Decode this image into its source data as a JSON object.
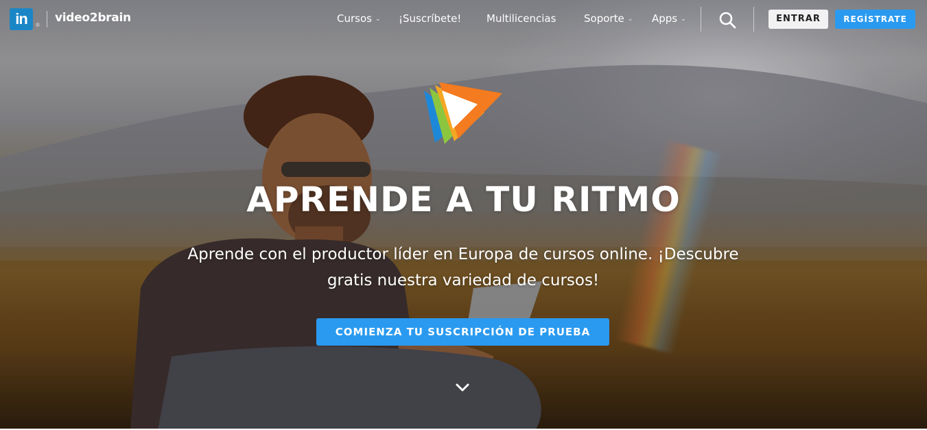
{
  "header": {
    "logo_in": "in",
    "logo_text": "video2brain",
    "nav": [
      {
        "label": "Cursos",
        "has_dropdown": true
      },
      {
        "label": "¡Suscríbete!",
        "has_dropdown": false
      },
      {
        "label": "Multilicencias",
        "has_dropdown": false
      },
      {
        "label": "Soporte",
        "has_dropdown": true
      },
      {
        "label": "Apps",
        "has_dropdown": true
      }
    ],
    "search_icon": "search-icon",
    "login_label": "ENTRAR",
    "register_label": "REGÍSTRATE"
  },
  "hero": {
    "headline": "APRENDE A TU RITMO",
    "subtitle": "Aprende con el productor líder en Europa de cursos online. ¡Descubre gratis nuestra variedad de cursos!",
    "cta_label": "COMIENZA TU SUSCRIPCIÓN DE PRUEBA",
    "scroll_icon": "chevron-down-icon"
  },
  "colors": {
    "accent": "#2a9af0",
    "linkedin_blue": "#1b86c6",
    "login_bg": "#f2f2f2"
  }
}
